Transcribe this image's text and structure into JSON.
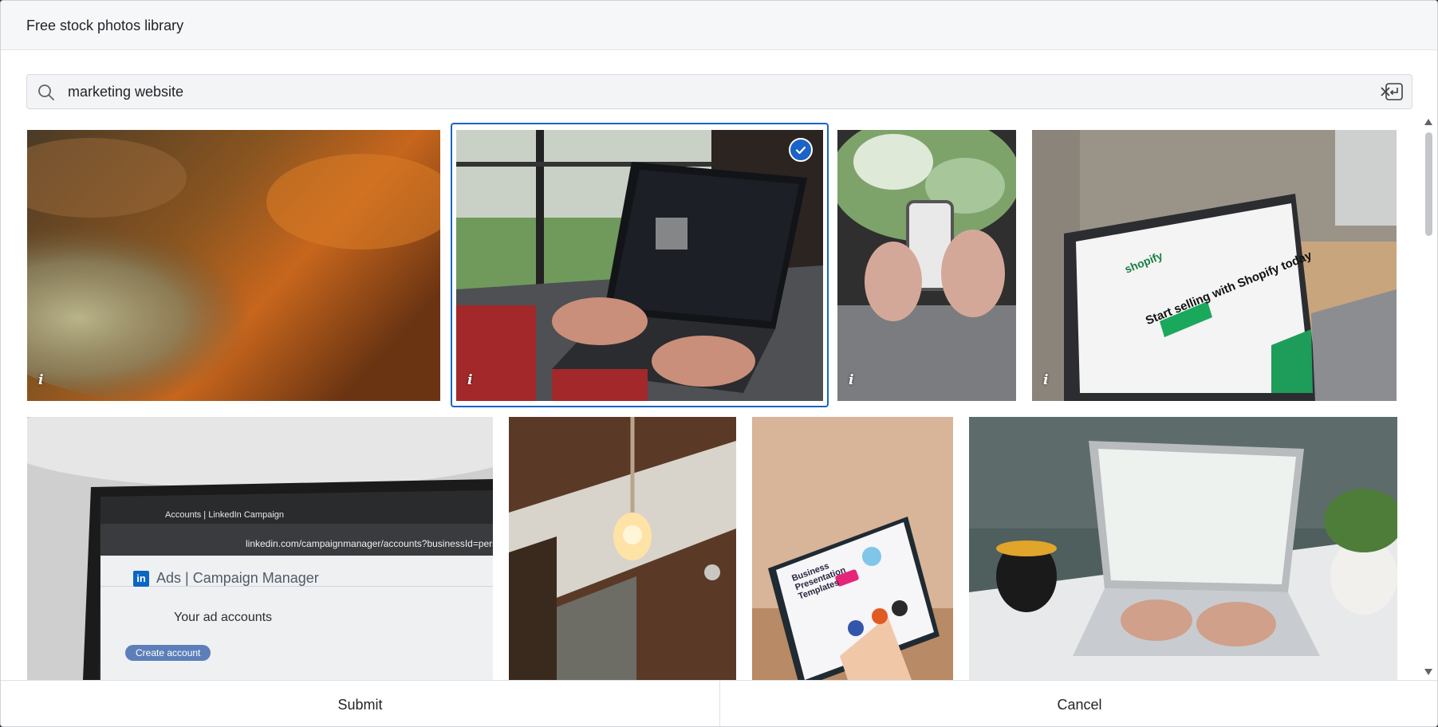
{
  "dialog": {
    "title": "Free stock photos library"
  },
  "search": {
    "value": "marketing website"
  },
  "gallery": {
    "info_label": "i",
    "selected_index": 1,
    "tiles": [
      {
        "name": "photo-lichen-rock"
      },
      {
        "name": "photo-laptop-typing-dark"
      },
      {
        "name": "photo-phone-flowers"
      },
      {
        "name": "photo-shopify-laptop"
      },
      {
        "name": "photo-linkedin-campaign-manager"
      },
      {
        "name": "photo-lightbulb-ceiling"
      },
      {
        "name": "photo-tablet-presentation"
      },
      {
        "name": "photo-laptop-coffee"
      }
    ]
  },
  "linkedin_shot": {
    "tab_text": "Accounts | LinkedIn Campaign",
    "url_text": "linkedin.com/campaignmanager/accounts?businessId=pers",
    "brand": "in",
    "product": "Ads | Campaign Manager",
    "heading": "Your ad accounts",
    "button": "Create account"
  },
  "shopify_shot": {
    "brand": "shopify",
    "headline": "Start selling with Shopify today"
  },
  "tablet_shot": {
    "headline": "Business Presentation Templates"
  },
  "footer": {
    "submit_label": "Submit",
    "cancel_label": "Cancel"
  },
  "colors": {
    "accent": "#1a63c7",
    "header_bg": "#f6f7f9"
  }
}
